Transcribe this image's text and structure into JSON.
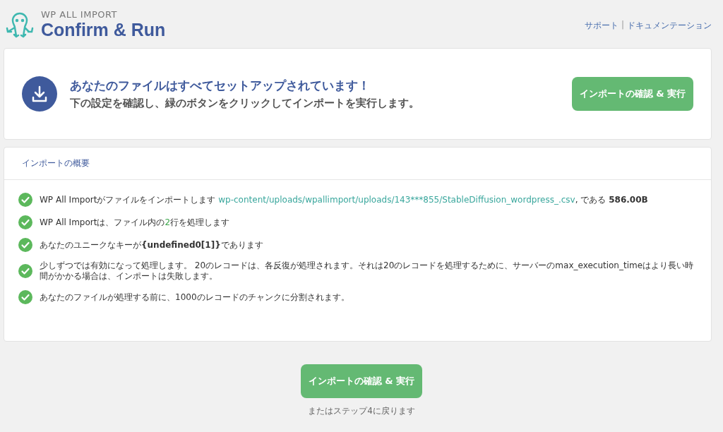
{
  "header": {
    "brand": "WP ALL IMPORT",
    "title": "Confirm & Run",
    "links": [
      "サポート",
      "ドキュメンテーション"
    ],
    "separator": "|"
  },
  "ready": {
    "heading": "あなたのファイルはすべてセットアップされています！",
    "subtext": "下の設定を確認し、緑のボタンをクリックしてインポートを実行します。",
    "button": "インポートの確認 & 実行"
  },
  "summary": {
    "title": "インポートの概要",
    "items": [
      {
        "segments": [
          {
            "kind": "text",
            "text": "WP All Importがファイルをインポートします "
          },
          {
            "kind": "link",
            "text": "wp-content/uploads/wpallimport/uploads/143***855/StableDiffusion_wordpress_.csv"
          },
          {
            "kind": "text",
            "text": ", である **586.00B**"
          }
        ]
      },
      {
        "segments": [
          {
            "kind": "text",
            "text": "WP All Importは、ファイル内の"
          },
          {
            "kind": "accent",
            "text": "2"
          },
          {
            "kind": "text",
            "text": "行を処理します"
          }
        ]
      },
      {
        "segments": [
          {
            "kind": "text",
            "text": "あなたのユニークなキーが**{undefined0[1]}**であります"
          }
        ]
      },
      {
        "segments": [
          {
            "kind": "text",
            "text": "少しずつでは有効になって処理します。 20のレコードは、各反復が処理されます。それは20のレコードを処理するために、サーバーのmax_execution_timeはより長い時間がかかる場合は、インポートは失敗します。"
          }
        ]
      },
      {
        "segments": [
          {
            "kind": "text",
            "text": "あなたのファイルが処理する前に、1000のレコードのチャンクに分割されます。"
          }
        ]
      }
    ]
  },
  "footer": {
    "button": "インポートの確認 & 実行",
    "back": "またはステップ4に戻ります"
  }
}
